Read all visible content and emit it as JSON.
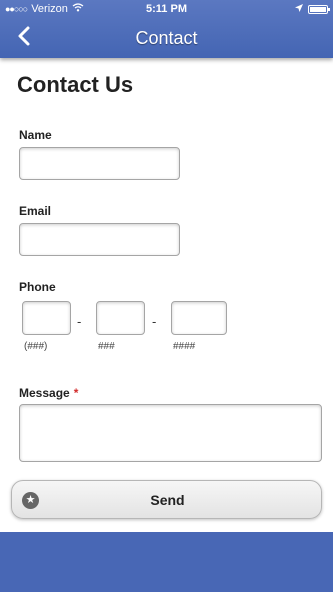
{
  "status_bar": {
    "signal_dots": "●●○○○",
    "carrier": "Verizon",
    "wifi": "wifi-icon",
    "time": "5:11 PM",
    "location": "location-arrow-icon",
    "battery": "battery-icon"
  },
  "nav": {
    "title": "Contact",
    "back_icon": "chevron-left-icon"
  },
  "page": {
    "heading": "Contact Us"
  },
  "form": {
    "name_label": "Name",
    "name_value": "",
    "email_label": "Email",
    "email_value": "",
    "phone_label": "Phone",
    "phone_sep1": "-",
    "phone_sep2": "-",
    "phone_hint_area": "(###)",
    "phone_hint_prefix": "###",
    "phone_hint_line": "####",
    "message_label": "Message",
    "message_required": "*",
    "message_value": ""
  },
  "send_button": {
    "label": "Send",
    "icon": "star-icon"
  },
  "colors": {
    "header": "#4a68b5",
    "footer": "#4867b5",
    "required": "#d12b2b"
  }
}
